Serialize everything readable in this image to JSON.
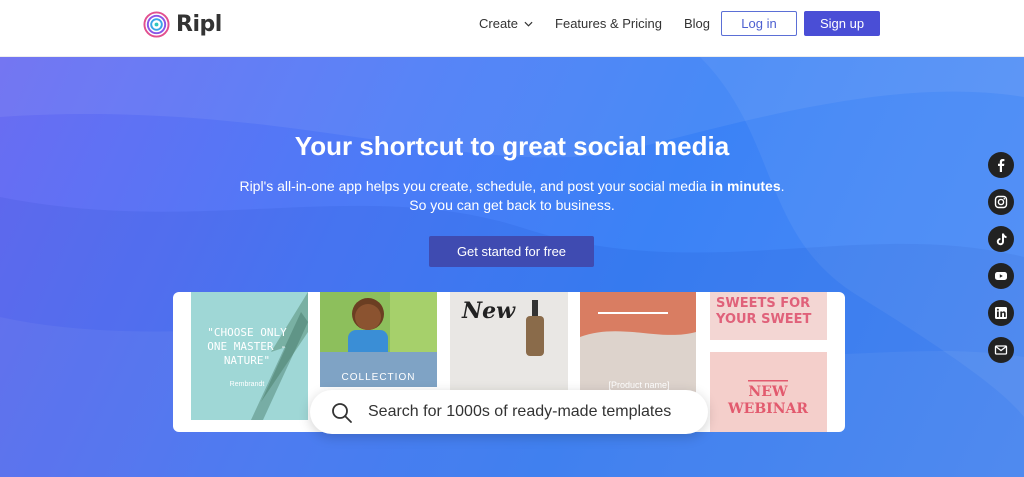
{
  "nav": {
    "logo_text": "Ripl",
    "links": [
      {
        "label": "Create"
      },
      {
        "label": "Features & Pricing"
      },
      {
        "label": "Blog"
      }
    ],
    "login_label": "Log in",
    "signup_label": "Sign up"
  },
  "hero": {
    "title": "Your shortcut to great social media",
    "subtitle_part1": "Ripl's all-in-one app helps you create, schedule, and post your social media ",
    "subtitle_bold": "in minutes",
    "subtitle_part2": ".",
    "subtitle_line2": "So you can get back to business.",
    "cta_label": "Get started for free"
  },
  "social_icons": [
    "facebook-icon",
    "instagram-icon",
    "tiktok-icon",
    "youtube-icon",
    "linkedin-icon",
    "mail-icon"
  ],
  "gallery": {
    "tile1_quote": "\"CHOOSE ONLY ONE MASTER - NATURE\"",
    "tile1_author": "Rembrandt",
    "tile3_text": "New",
    "tile4_text": "[Product name] drops tomorrow @",
    "tile5_text": "SWEETS FOR YOUR SWEET",
    "tile6_text": "NEW WEBINAR",
    "tile2_text": "COLLECTION"
  },
  "search": {
    "placeholder": "Search for 1000s of ready-made templates"
  },
  "colors": {
    "brand": "#4a4ed6",
    "cta": "#3f4bb1",
    "hero_gradient_start": "#6a6cf2",
    "hero_gradient_end": "#3b82f6"
  }
}
